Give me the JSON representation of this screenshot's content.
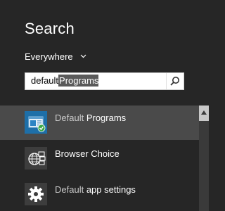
{
  "header": {
    "title": "Search",
    "scope_label": "Everywhere"
  },
  "search": {
    "typed": "default",
    "suggestion": "Programs"
  },
  "results": [
    {
      "label_dim": "Default",
      "label_bright": " Programs",
      "icon": "default-programs-icon"
    },
    {
      "label_dim": "",
      "label_bright": "Browser Choice",
      "icon": "browser-choice-icon"
    },
    {
      "label_dim": "Default",
      "label_bright": " app settings",
      "icon": "gear-icon"
    }
  ],
  "colors": {
    "background": "#262626",
    "selected_row": "#4a4a4a",
    "tile_blue": "#1e6fa8",
    "tile_gray": "#3d3d3d",
    "check_green": "#3aa845"
  }
}
